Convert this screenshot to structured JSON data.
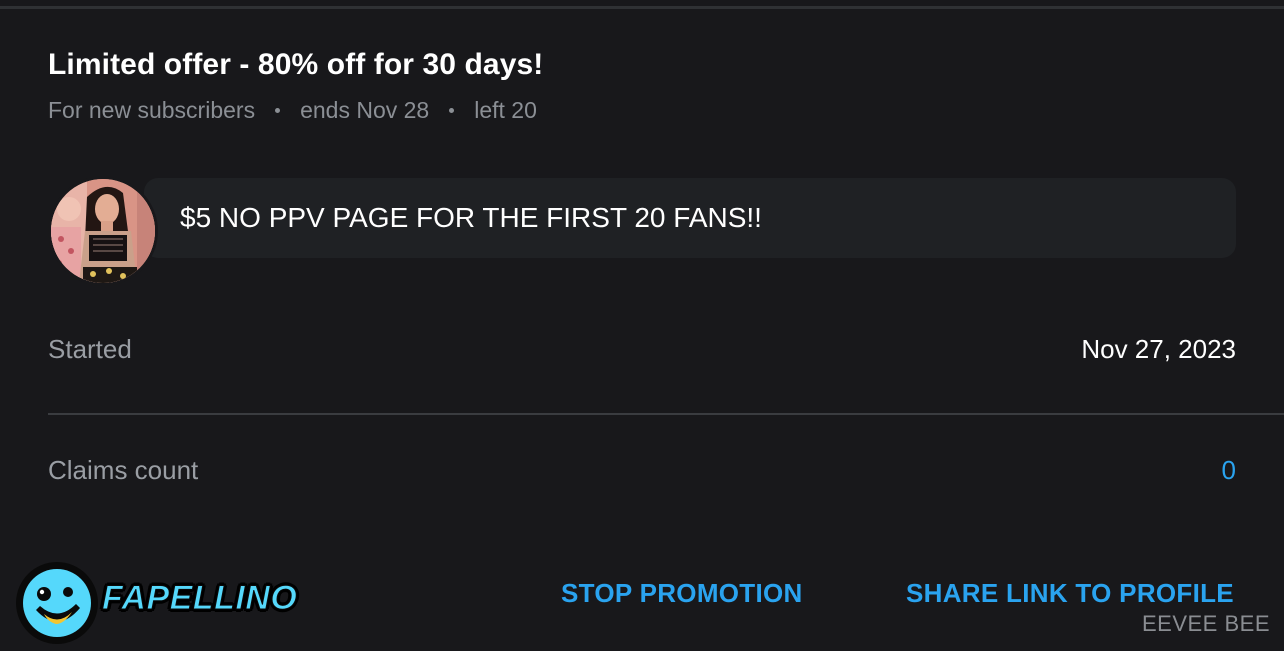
{
  "offer": {
    "title": "Limited offer - 80% off for 30 days!",
    "audience": "For new subscribers",
    "ends": "ends Nov 28",
    "left": "left 20"
  },
  "message": {
    "text": "$5 NO PPV PAGE FOR THE FIRST 20 FANS!!"
  },
  "details": {
    "started_label": "Started",
    "started_value": "Nov 27, 2023",
    "claims_label": "Claims count",
    "claims_value": "0"
  },
  "actions": {
    "stop_label": "STOP PROMOTION",
    "share_label": "SHARE LINK TO PROFILE"
  },
  "branding": {
    "logo_text": "FAPELLINO",
    "watermark": "EEVEE BEE"
  },
  "colors": {
    "background": "#18181b",
    "accent": "#2aa3ef",
    "bubble": "#1f2124",
    "logo": "#55d8fb"
  }
}
